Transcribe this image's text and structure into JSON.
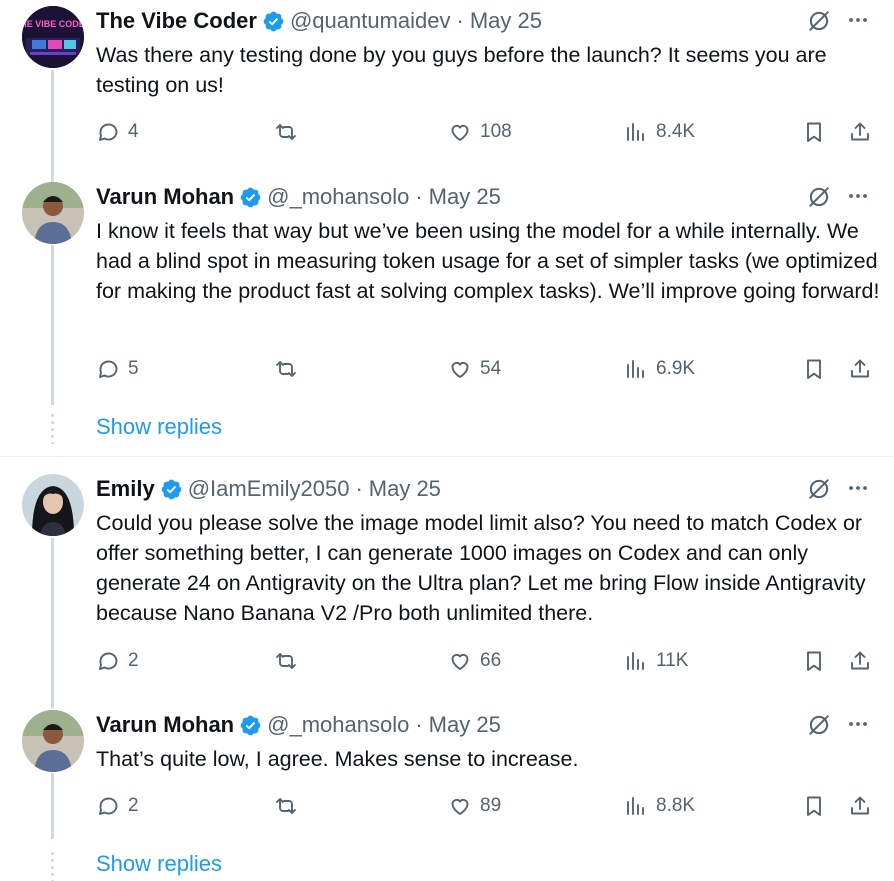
{
  "tweets": [
    {
      "name": "The Vibe Coder",
      "handle": "@quantumaidev",
      "date": "May 25",
      "avatar_text": "THE VIBE CODER",
      "text": "Was there any testing done by you guys before the launch? It seems you are testing on us!",
      "replies": "4",
      "retweets": "",
      "likes": "108",
      "views": "8.4K"
    },
    {
      "name": "Varun Mohan",
      "handle": "@_mohansolo",
      "date": "May 25",
      "text": "I know it feels that way but we’ve been using the model for a while internally. We had a blind spot in measuring token usage for a set of simpler tasks (we optimized for making the product fast at solving complex tasks). We’ll improve going forward!",
      "replies": "5",
      "retweets": "",
      "likes": "54",
      "views": "6.9K"
    },
    {
      "name": "Emily",
      "handle": "@IamEmily2050",
      "date": "May 25",
      "text": "Could you please solve the image model limit also? You need to match Codex or offer something better, I can generate 1000 images on Codex and can only generate 24 on Antigravity on the Ultra plan? Let me bring Flow inside Antigravity because Nano Banana V2 /Pro both unlimited there.",
      "replies": "2",
      "retweets": "",
      "likes": "66",
      "views": "11K"
    },
    {
      "name": "Varun Mohan",
      "handle": "@_mohansolo",
      "date": "May 25",
      "text": "That’s quite low, I agree. Makes sense to increase.",
      "replies": "2",
      "retweets": "",
      "likes": "89",
      "views": "8.8K"
    }
  ],
  "show_replies_label": "Show replies",
  "separator": "·",
  "colors": {
    "accent": "#1d9bf0",
    "muted": "#536471",
    "text": "#0f1419",
    "line": "#cfd9de"
  },
  "icons": [
    "verified-badge-icon",
    "grok-icon",
    "more-icon",
    "reply-icon",
    "retweet-icon",
    "like-icon",
    "views-icon",
    "bookmark-icon",
    "share-icon"
  ]
}
